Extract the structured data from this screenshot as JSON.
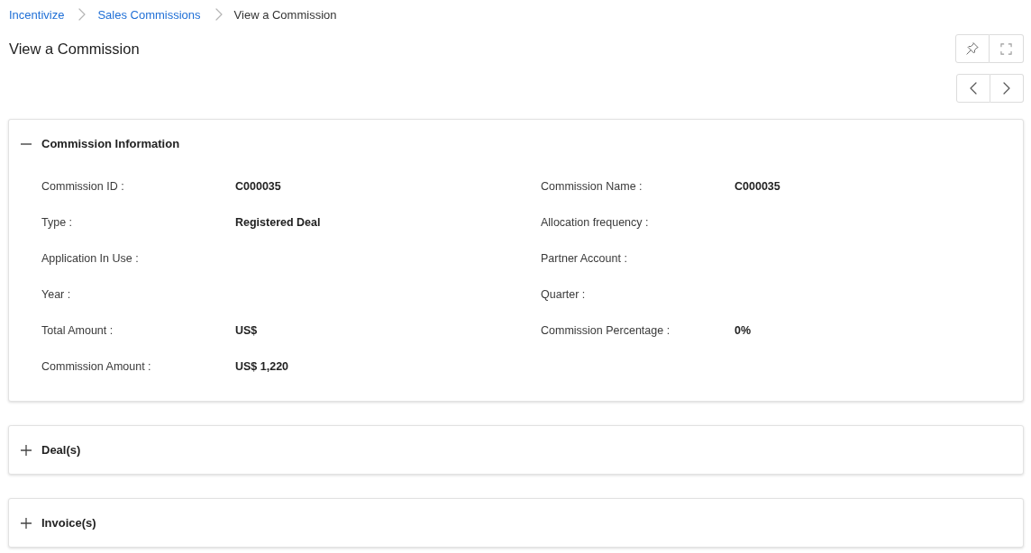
{
  "breadcrumb": [
    {
      "label": "Incentivize",
      "kind": "link"
    },
    {
      "label": "Sales Commissions",
      "kind": "link"
    },
    {
      "label": "View a Commission",
      "kind": "current"
    }
  ],
  "page_title": "View a Commission",
  "sections": [
    {
      "title": "Commission Information",
      "expanded": true,
      "fields": [
        {
          "label": "Commission ID :",
          "value": "C000035"
        },
        {
          "label": "Commission Name :",
          "value": "C000035"
        },
        {
          "label": "Type :",
          "value": "Registered Deal"
        },
        {
          "label": "Allocation frequency :"
        },
        {
          "label": "Application In Use :"
        },
        {
          "label": "Partner Account :"
        },
        {
          "label": "Year :"
        },
        {
          "label": "Quarter :"
        },
        {
          "label": "Total Amount :",
          "value": "US$"
        },
        {
          "label": "Commission Percentage :",
          "value": "0%"
        },
        {
          "label": "Commission Amount :",
          "value": "US$ 1,220"
        }
      ]
    },
    {
      "title": "Deal(s)",
      "expanded": false
    },
    {
      "title": "Invoice(s)",
      "expanded": false
    }
  ]
}
